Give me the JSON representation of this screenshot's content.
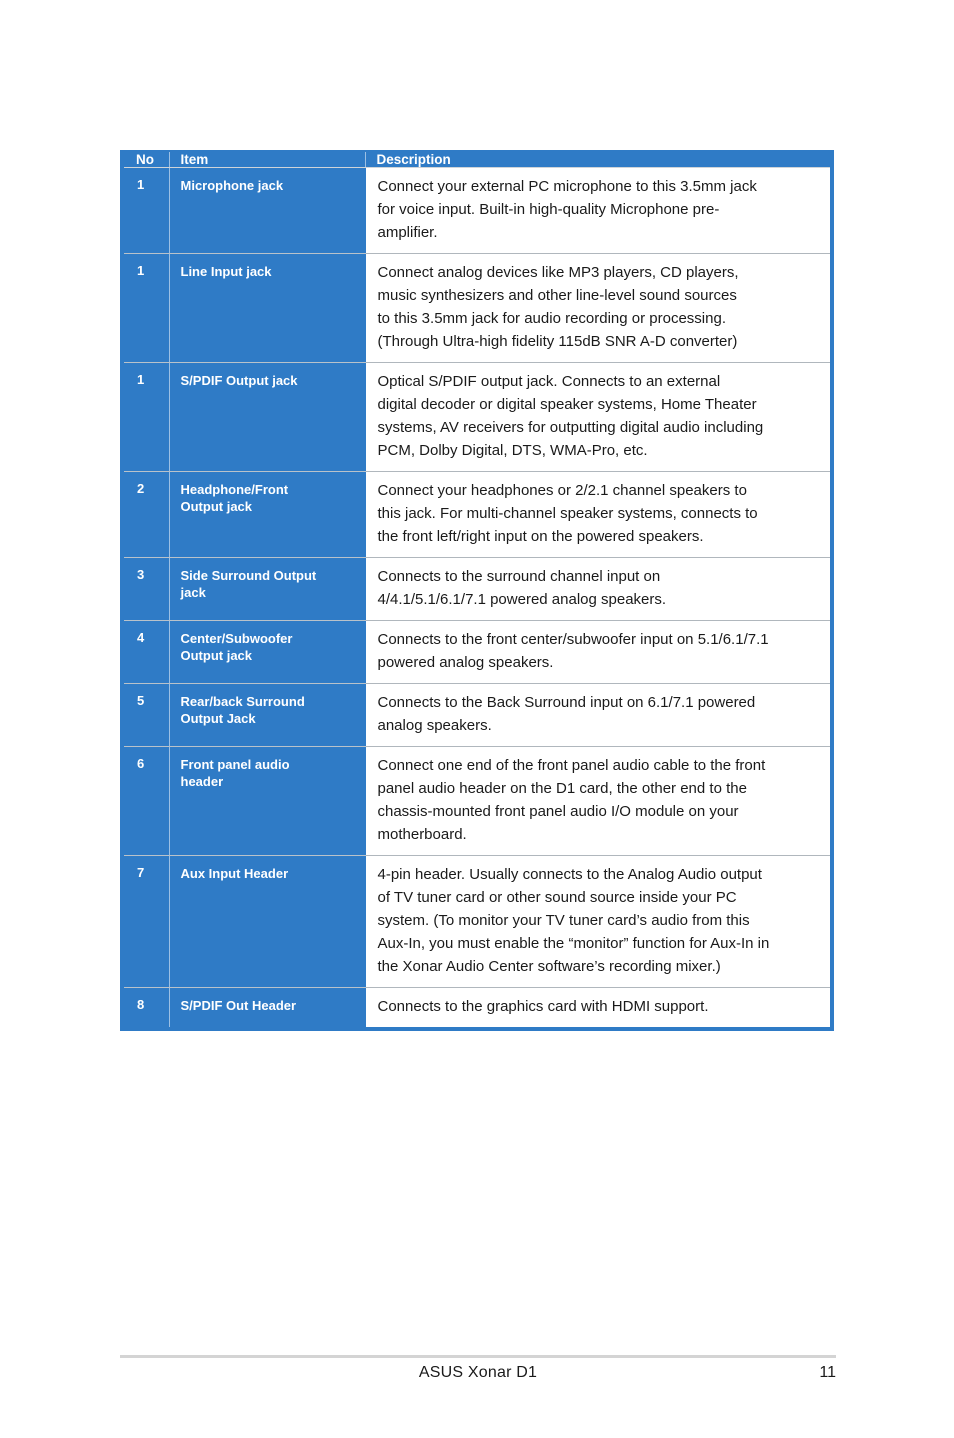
{
  "document": {
    "footer": {
      "title": "ASUS Xonar D1",
      "page_number": "11"
    }
  },
  "colors": {
    "table_blue": "#2f7bc6",
    "header_text": "#ffffff",
    "body_text": "#1a1a1a",
    "row_divider": "#b0b7bd",
    "footer_rule": "#d4d4d4"
  },
  "table": {
    "headers": {
      "no": "No",
      "item": "Item",
      "description": "Description"
    },
    "rows": [
      {
        "no": "1",
        "item": "Microphone jack",
        "description": "Connect your external PC microphone to this 3.5mm jack for voice input. Built-in high-quality Microphone pre-amplifier.",
        "description_lines": [
          "Connect your external PC microphone to this 3.5mm jack",
          "for voice input. Built-in high-quality Microphone pre-",
          "amplifier."
        ]
      },
      {
        "no": "1",
        "item": "Line Input jack",
        "description": "Connect analog devices like MP3 players, CD players, music synthesizers and other line-level sound sources to this 3.5mm jack for audio recording or processing. (Through Ultra-high fidelity 115dB SNR A-D converter)",
        "description_lines": [
          "Connect analog devices like MP3 players, CD players,",
          "music synthesizers and other line-level sound sources",
          "to this 3.5mm jack for audio recording or processing.",
          "(Through Ultra-high fidelity 115dB SNR A-D converter)"
        ]
      },
      {
        "no": "1",
        "item": "S/PDIF Output jack",
        "description": "Optical S/PDIF output jack. Connects to an external digital decoder or digital speaker systems, Home Theater systems, AV receivers for outputting digital audio including PCM, Dolby Digital, DTS, WMA-Pro, etc.",
        "description_lines": [
          "Optical S/PDIF output jack. Connects to an external",
          "digital decoder or digital speaker systems, Home Theater",
          "systems, AV receivers for outputting digital audio including",
          "PCM, Dolby Digital, DTS, WMA-Pro, etc."
        ]
      },
      {
        "no": "2",
        "item": "Headphone/Front Output jack",
        "item_lines": [
          "Headphone/Front",
          "Output jack"
        ],
        "description": "Connect your headphones or 2/2.1 channel speakers to this jack. For multi-channel speaker systems, connects to the front left/right input on the powered speakers.",
        "description_lines": [
          "Connect your headphones or 2/2.1 channel speakers to",
          "this jack. For multi-channel speaker systems, connects to",
          "the front left/right input on the powered speakers."
        ]
      },
      {
        "no": "3",
        "item": "Side Surround Output jack",
        "item_lines": [
          "Side Surround Output",
          "jack"
        ],
        "description": "Connects to the surround channel input on 4/4.1/5.1/6.1/7.1 powered analog speakers.",
        "description_lines": [
          "Connects to the surround channel input on",
          "4/4.1/5.1/6.1/7.1 powered analog speakers."
        ]
      },
      {
        "no": "4",
        "item": "Center/Subwoofer Output jack",
        "item_lines": [
          "Center/Subwoofer",
          "Output jack"
        ],
        "description": "Connects to the front center/subwoofer input on 5.1/6.1/7.1 powered analog speakers.",
        "description_lines": [
          "Connects to the front center/subwoofer input on 5.1/6.1/7.1",
          "powered analog speakers."
        ]
      },
      {
        "no": "5",
        "item": "Rear/back Surround Output Jack",
        "item_lines": [
          "Rear/back Surround",
          "Output Jack"
        ],
        "description": "Connects to the Back Surround input on 6.1/7.1 powered analog speakers.",
        "description_lines": [
          "Connects to the Back Surround input on 6.1/7.1 powered",
          "analog speakers."
        ]
      },
      {
        "no": "6",
        "item": "Front panel audio header",
        "item_lines": [
          "Front panel audio",
          "header"
        ],
        "description": "Connect one end of the front panel audio cable to the front panel audio header on the D1 card, the other end to the chassis-mounted front panel audio I/O module on your motherboard.",
        "description_lines": [
          "Connect one end of the front panel audio cable to the front",
          "panel audio header on the D1 card, the other end to the",
          "chassis-mounted front panel audio I/O module on your",
          "motherboard."
        ]
      },
      {
        "no": "7",
        "item": "Aux Input Header",
        "description": "4-pin header. Usually connects to the Analog Audio output of TV tuner card or other sound source inside your PC system. (To monitor your TV tuner card’s audio from this Aux-In, you must enable the “monitor” function for Aux-In in the Xonar Audio Center software’s recording mixer.)",
        "description_lines": [
          "4-pin header. Usually connects to the Analog Audio output",
          "of TV tuner card or other sound source inside your PC",
          "system. (To monitor your TV tuner card’s audio from this",
          "Aux-In, you must enable the “monitor” function for Aux-In in",
          "the Xonar Audio Center software’s recording mixer.)"
        ]
      },
      {
        "no": "8",
        "item": "S/PDIF Out Header",
        "description": "Connects to the graphics card with HDMI support.",
        "description_lines": [
          "Connects to the graphics card with HDMI support."
        ]
      }
    ]
  }
}
